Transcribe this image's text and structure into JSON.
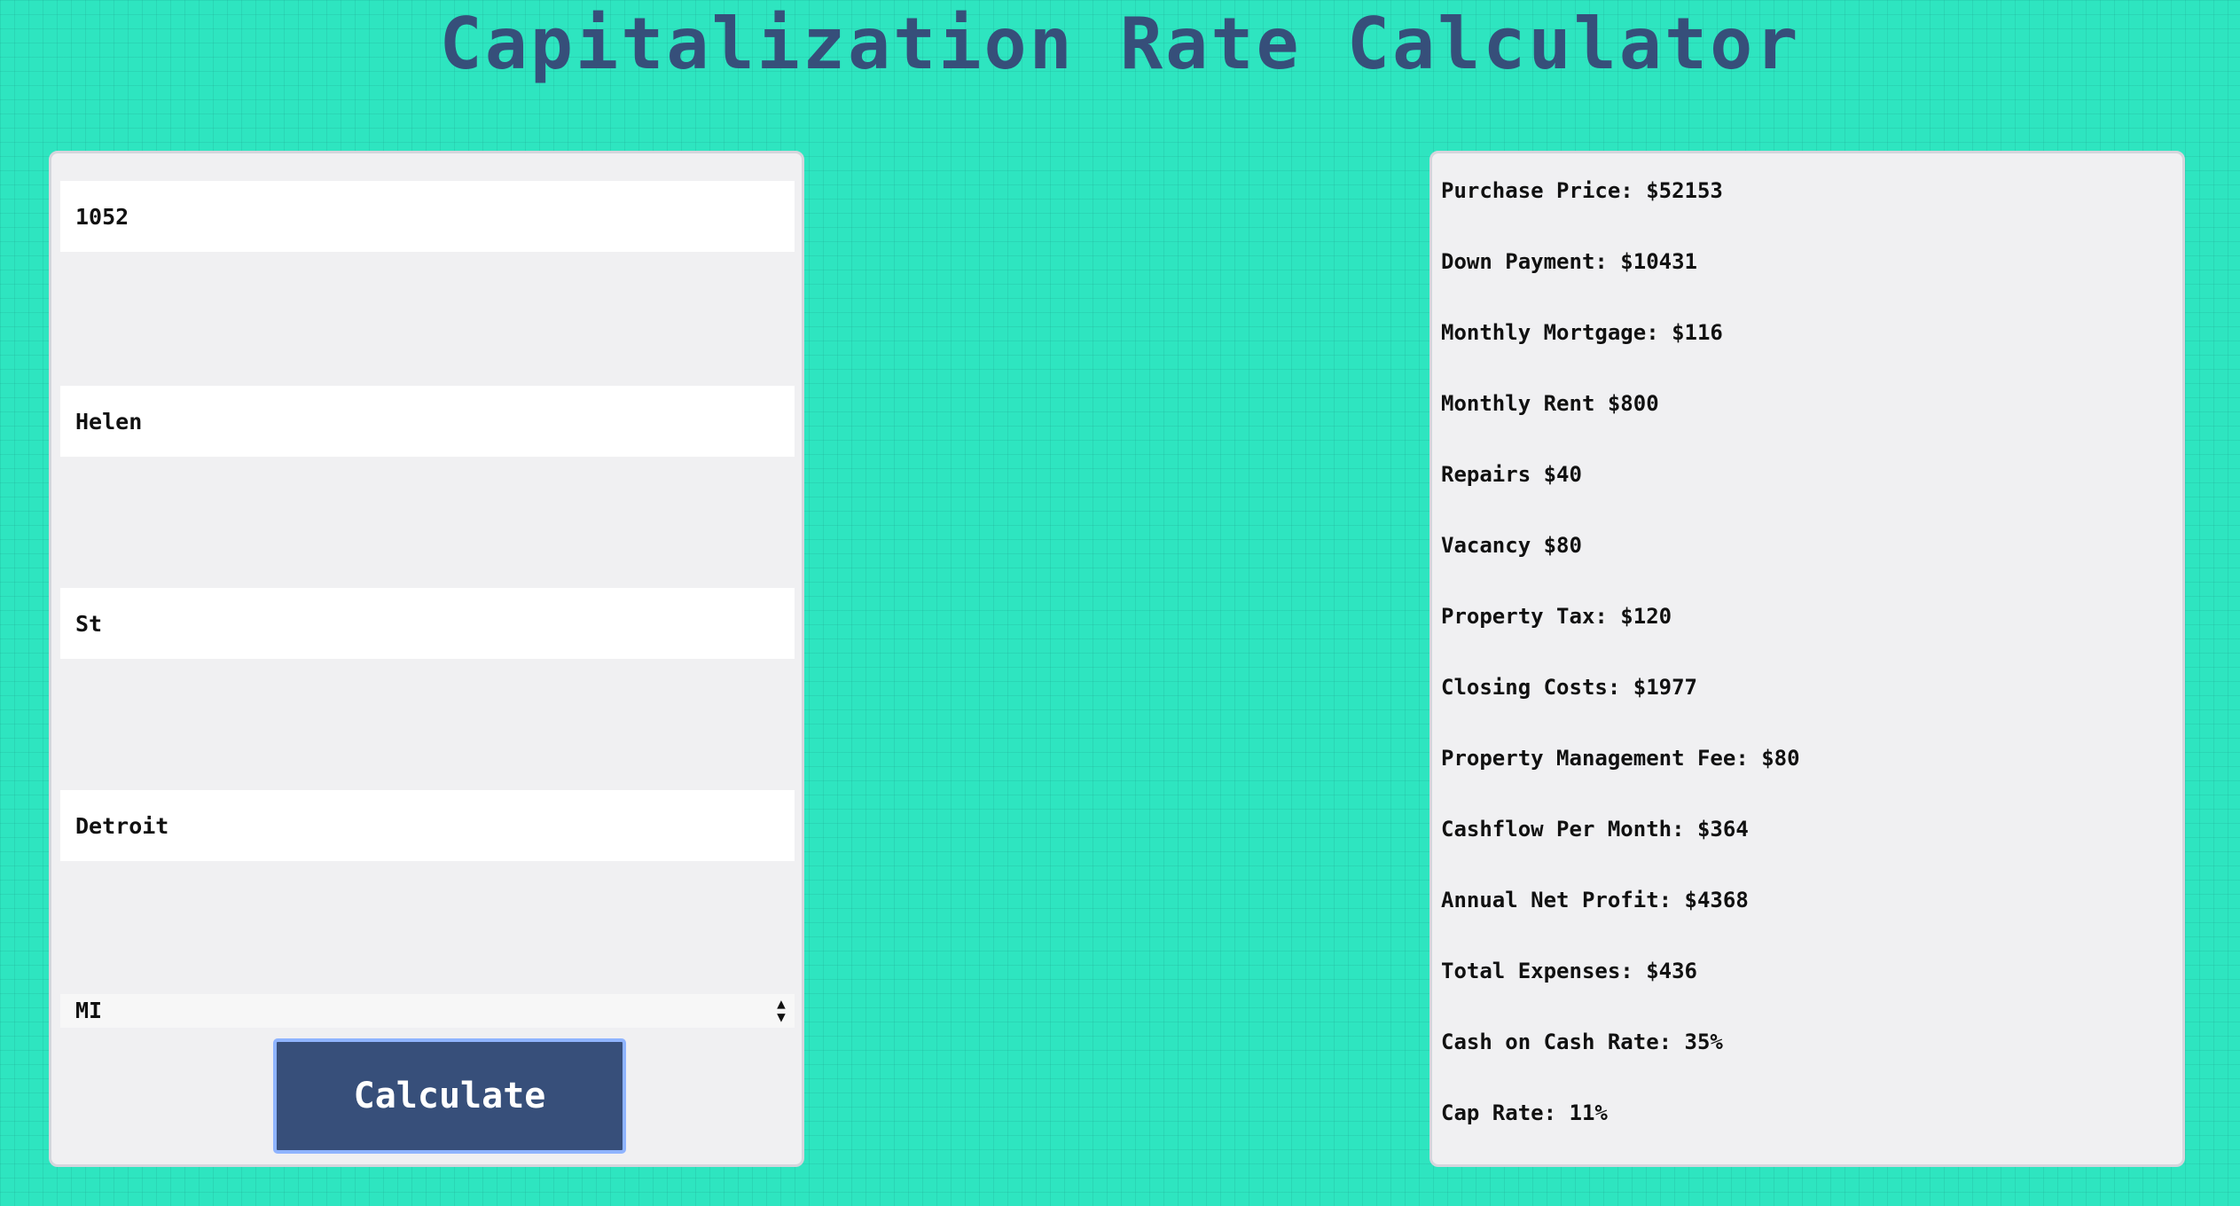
{
  "page": {
    "title": "Capitalization Rate Calculator"
  },
  "form": {
    "fields": [
      {
        "name": "house-number-input",
        "value": "1052"
      },
      {
        "name": "street-name-input",
        "value": "Helen"
      },
      {
        "name": "street-suffix-input",
        "value": "St"
      },
      {
        "name": "city-input",
        "value": "Detroit"
      }
    ],
    "state_select": {
      "value": "MI"
    },
    "calculate_label": "Calculate"
  },
  "results": {
    "items": [
      "Purchase Price: $52153",
      "Down Payment: $10431",
      "Monthly Mortgage: $116",
      "Monthly Rent $800",
      "Repairs $40",
      "Vacancy $80",
      "Property Tax: $120",
      "Closing Costs: $1977",
      "Property Management Fee: $80",
      "Cashflow Per Month: $364",
      "Annual Net Profit: $4368",
      "Total Expenses: $436",
      "Cash on Cash Rate: 35%",
      "Cap Rate: 11%"
    ]
  },
  "colors": {
    "background": "#2ee5c0",
    "title": "#364f7a",
    "button": "#374f7a",
    "button_border": "#8fb4ff",
    "panel": "#f0f0f2"
  },
  "icons": {
    "select_arrows": "updown-arrows-icon"
  }
}
